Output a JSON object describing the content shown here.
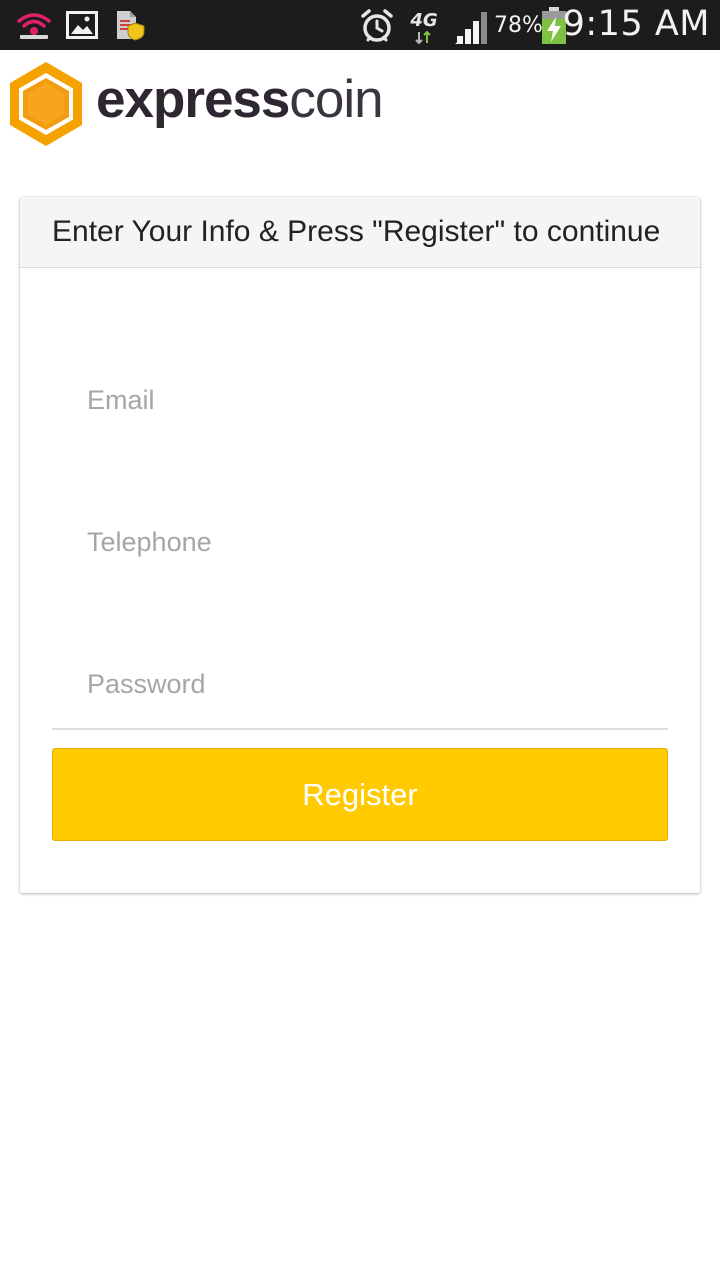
{
  "status_bar": {
    "icons": [
      "wifi-hotspot-icon",
      "gallery-image-icon",
      "secure-document-icon",
      "alarm-clock-icon",
      "network-4g-icon",
      "signal-strength-icon",
      "battery-charging-icon"
    ],
    "network_type": "4G",
    "battery_percent": "78%",
    "time": "9:15 AM"
  },
  "brand": {
    "logo_icon": "hexagon-coin-logo-icon",
    "name_bold": "express",
    "name_light": "coin",
    "accent_color": "#f39c12"
  },
  "form": {
    "title": "Enter Your Info & Press \"Register\" to continue",
    "email_placeholder": "Email",
    "telephone_placeholder": "Telephone",
    "password_placeholder": "Password",
    "register_label": "Register",
    "button_color": "#ffcb00"
  }
}
